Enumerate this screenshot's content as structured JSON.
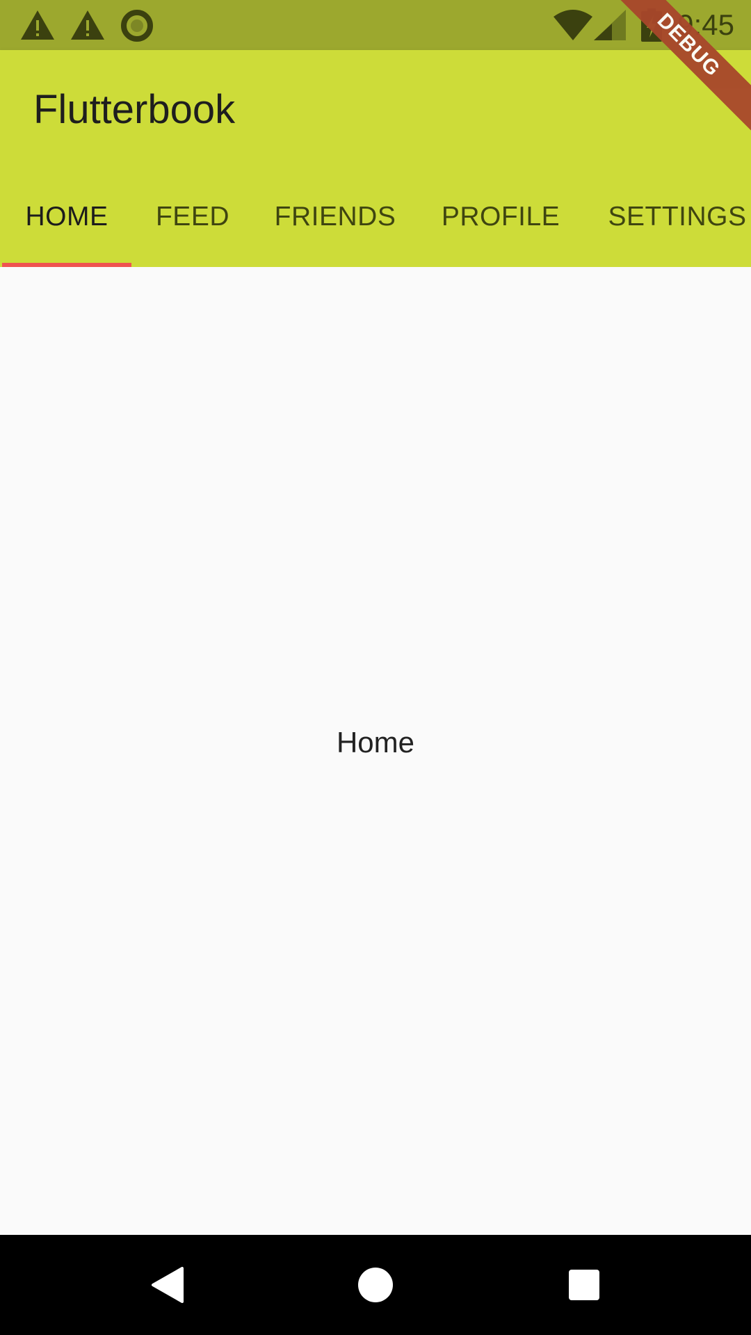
{
  "status_bar": {
    "time": "9:45",
    "left_icons": [
      "warning-icon",
      "warning-icon",
      "ring-icon"
    ],
    "right_icons": [
      "wifi-icon",
      "cellular-signal-icon",
      "battery-charging-icon"
    ],
    "color": "#9ca82e"
  },
  "app_bar": {
    "title": "Flutterbook",
    "color": "#cddc39"
  },
  "tabs": [
    {
      "label": "HOME",
      "active": true
    },
    {
      "label": "FEED",
      "active": false
    },
    {
      "label": "FRIENDS",
      "active": false
    },
    {
      "label": "PROFILE",
      "active": false
    },
    {
      "label": "SETTINGS",
      "active": false
    }
  ],
  "tab_indicator_color": "#ef5350",
  "content": {
    "text": "Home"
  },
  "debug_banner": {
    "label": "DEBUG"
  },
  "nav_bar": {
    "icons": [
      "back-icon",
      "home-icon",
      "recents-icon"
    ]
  }
}
